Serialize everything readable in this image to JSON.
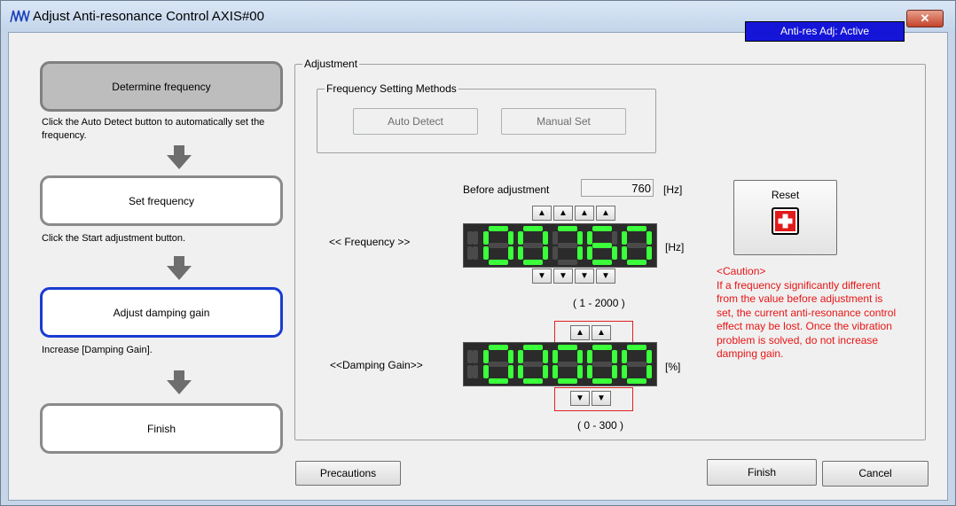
{
  "window": {
    "title": "Adjust Anti-resonance Control AXIS#00",
    "close_label": "✕"
  },
  "steps": [
    {
      "label": "Determine frequency",
      "desc": "Click the Auto Detect button to automatically set the frequency."
    },
    {
      "label": "Set frequency",
      "desc": "Click the Start adjustment button."
    },
    {
      "label": "Adjust damping gain",
      "desc": "Increase [Damping Gain]."
    },
    {
      "label": "Finish",
      "desc": ""
    }
  ],
  "adjustment": {
    "legend": "Adjustment",
    "status": "Anti-res Adj: Active",
    "methods_legend": "Frequency Setting Methods",
    "auto_detect_label": "Auto Detect",
    "manual_set_label": "Manual Set",
    "before_label": "Before adjustment",
    "before_value": "760",
    "hz_unit": "[Hz]",
    "percent_unit": "[%]",
    "frequency_label": "<<  Frequency  >>",
    "frequency_value": "00760",
    "frequency_range": "( 1 - 2000 )",
    "gain_label": "<<Damping Gain>>",
    "gain_value": "00000",
    "gain_range": "( 0 - 300 )",
    "up_glyph": "▲",
    "down_glyph": "▼",
    "reset_label": "Reset",
    "caution_title": "<Caution>",
    "caution_text": "If a frequency significantly different from the value before adjustment is set, the current anti-resonance control effect may be lost. Once the vibration problem is solved, do not increase damping gain."
  },
  "buttons": {
    "precautions": "Precautions",
    "finish": "Finish",
    "cancel": "Cancel"
  },
  "colors": {
    "status_bg": "#1515d8",
    "active_border": "#1a3bd1",
    "caution": "#e81515",
    "segment_on": "#3aff3a"
  }
}
